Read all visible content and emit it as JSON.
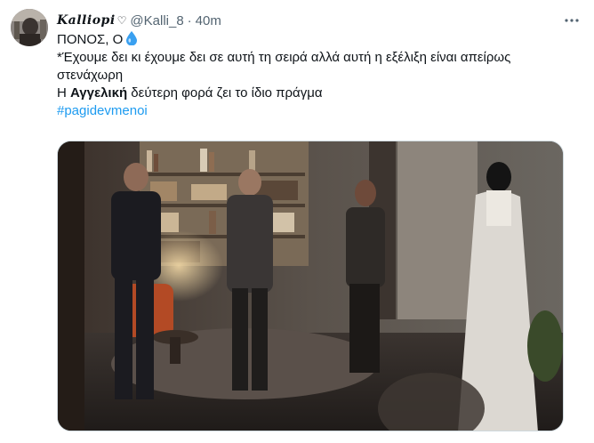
{
  "tweet": {
    "display_name": "Kalliopi",
    "name_icon": "heart-outline-icon",
    "handle": "@Kalli_8",
    "separator": "·",
    "time": "40m",
    "more_icon": "more-horizontal-icon",
    "lines": [
      "ΠΟΝΟΣ, Ο",
      "*Έχουμε δει κι έχουμε δει σε αυτή τη σειρά αλλά αυτή η εξέλιξη είναι απείρως στενάχωρη"
    ],
    "line3_prefix": "Η ",
    "line3_bold": "Αγγελική",
    "line3_suffix": " δεύτερη φορά ζει το ίδιο πράγμα",
    "hashtag": "#pagidevmenoi",
    "emoji_icon": "droplet-icon"
  },
  "colors": {
    "link": "#1d9bf0",
    "secondary_text": "#536471",
    "primary_text": "#0f1419",
    "droplet": "#3aa0f0"
  },
  "media": {
    "description_icon": "tv-scene-image"
  }
}
